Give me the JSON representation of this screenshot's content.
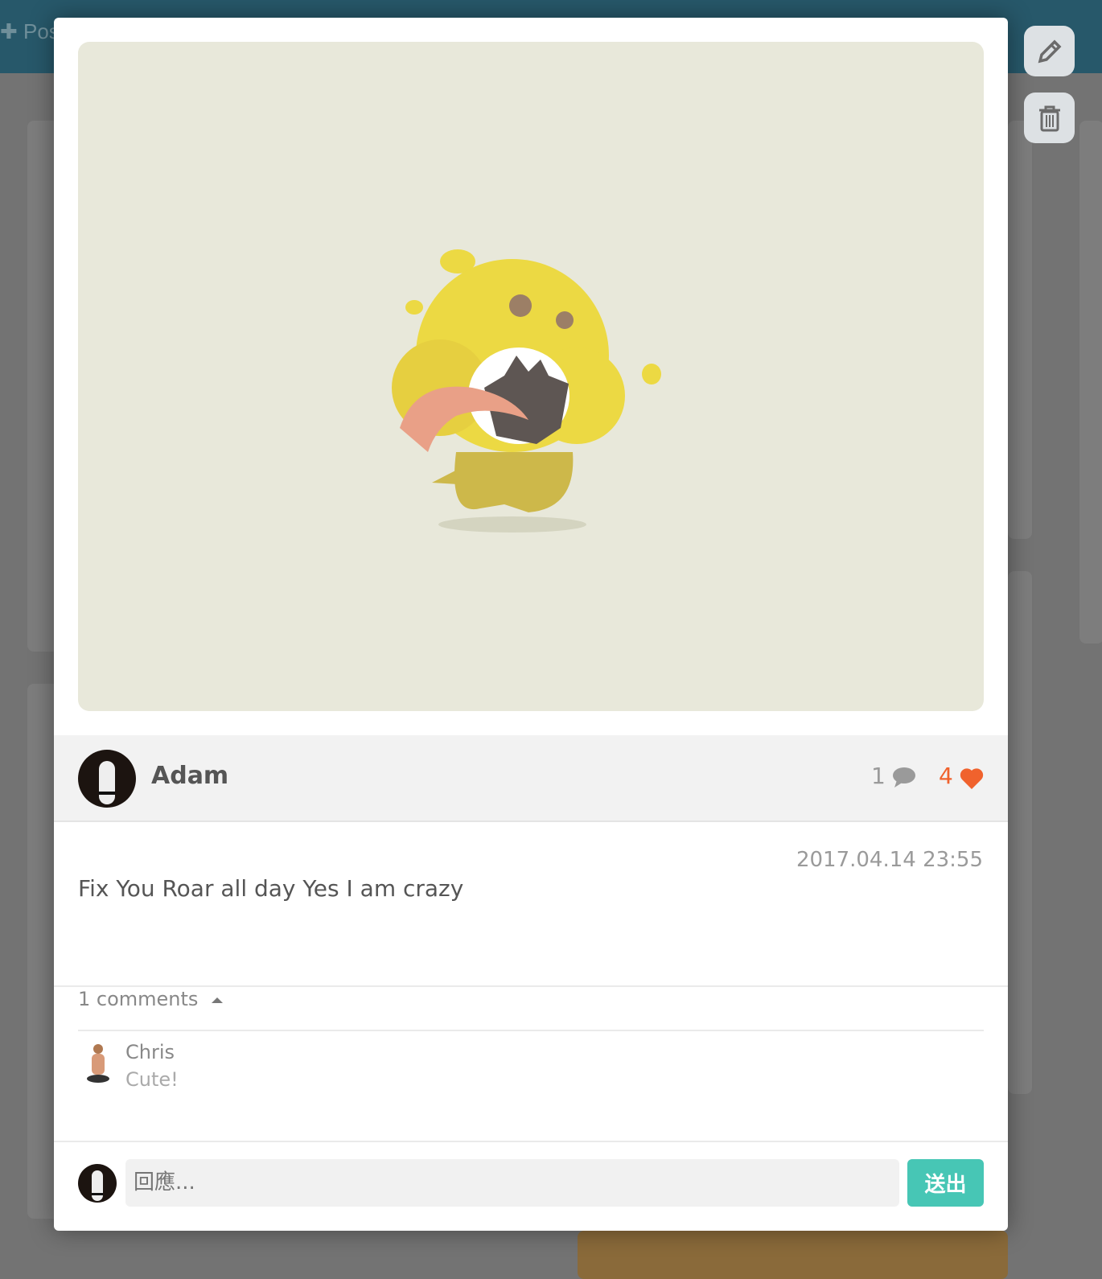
{
  "topbar": {
    "post_label": "✚ Pos"
  },
  "post": {
    "author": "Adam",
    "comment_count": "1",
    "like_count": "4",
    "timestamp": "2017.04.14 23:55",
    "text": "Fix You Roar all day Yes I am crazy"
  },
  "comments": {
    "toggle_label": "1 comments",
    "items": [
      {
        "name": "Chris",
        "text": "Cute!"
      }
    ]
  },
  "reply": {
    "placeholder": "回應...",
    "send_label": "送出"
  },
  "icons": {
    "comment": "speech-bubble-icon",
    "like": "heart-icon",
    "edit": "pencil-icon",
    "delete": "trash-icon",
    "toggle": "caret-up-icon"
  },
  "colors": {
    "accent": "#47c6b5",
    "like": "#f0622d",
    "topbar": "#27586a"
  }
}
